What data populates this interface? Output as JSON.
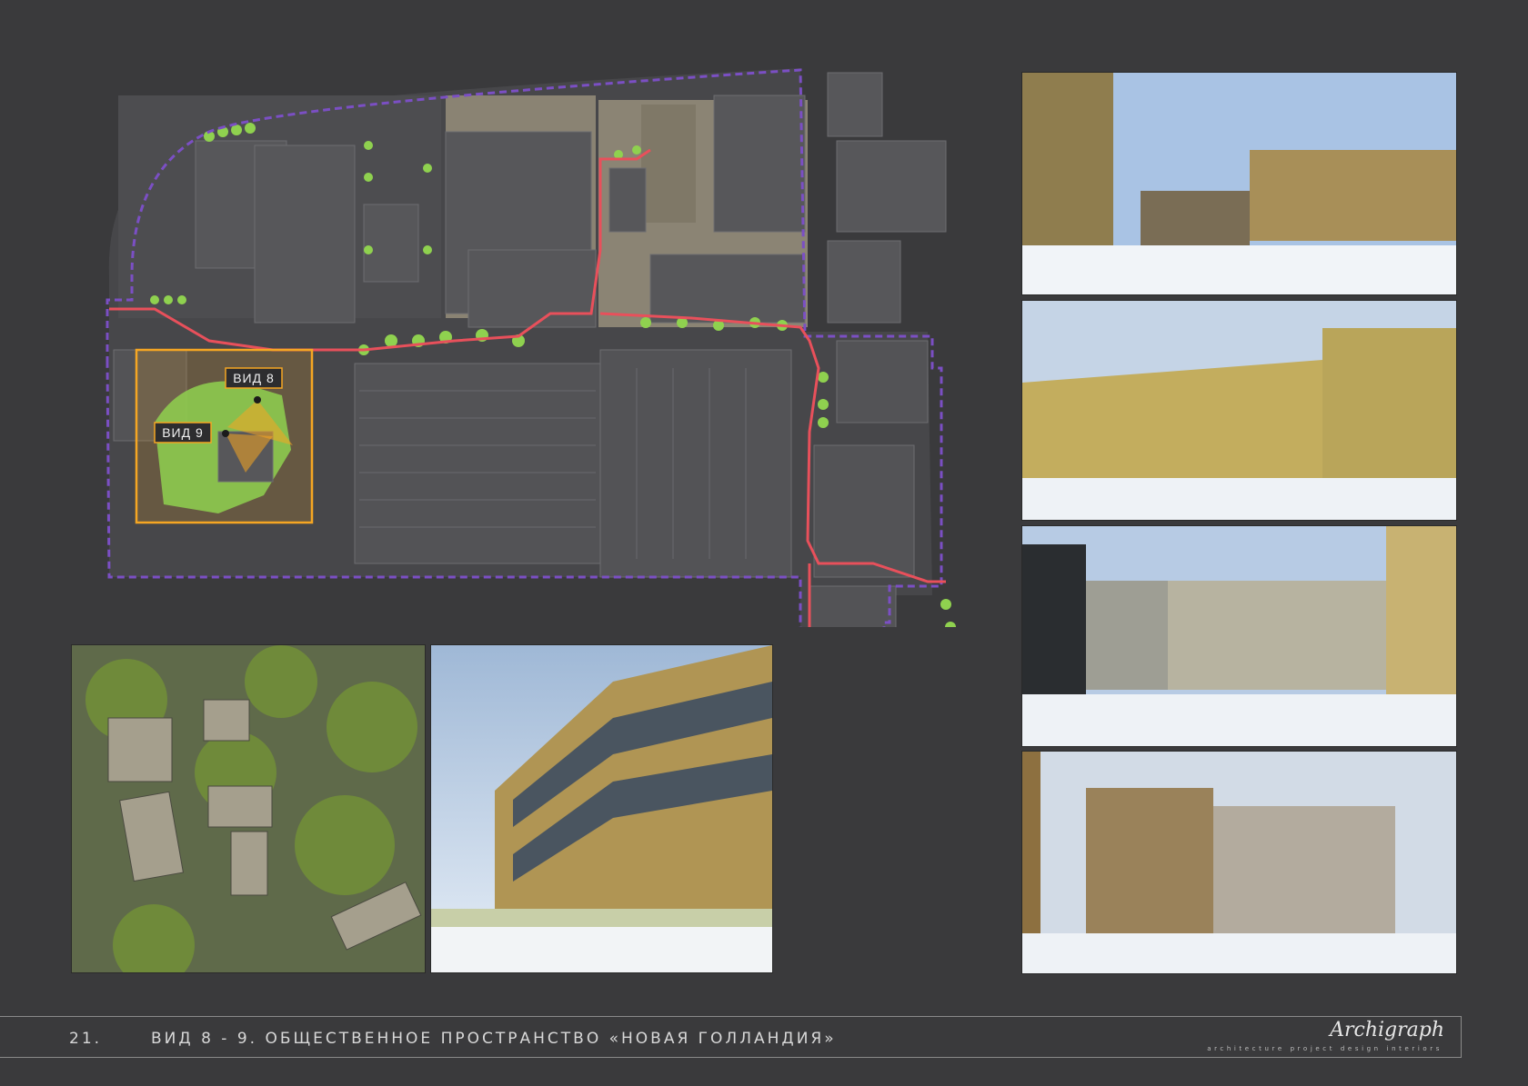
{
  "plan": {
    "view8_label": "ВИД 8",
    "view9_label": "ВИД 9",
    "colors": {
      "boundary": "#7b4fc4",
      "route": "#e8505b",
      "highlight": "#f5a623",
      "greenery": "#8fd14f",
      "block": "#57575a",
      "ground": "#7a7362"
    }
  },
  "footer": {
    "page_number": "21.",
    "title": "ВИД 8 - 9. ОБЩЕСТВЕННОЕ ПРОСТРАНСТВО «НОВАЯ ГОЛЛАНДИЯ»",
    "logo_signature": "Archigraph",
    "logo_tagline": "architecture  project  design  interiors"
  }
}
